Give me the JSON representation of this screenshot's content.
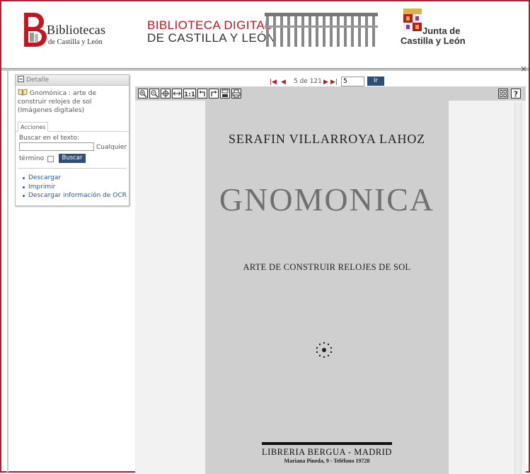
{
  "header": {
    "bibliotecas_logo": {
      "line1": "Bibliotecas",
      "line2": "de Castilla y León"
    },
    "digital_logo": {
      "line1": "BIBLIOTECA DIGITAL",
      "line2": "DE CASTILLA Y LEÓN"
    },
    "junta_logo": {
      "line1": "Junta de",
      "line2": "Castilla y León"
    },
    "close_glyph": "×"
  },
  "detalle_panel": {
    "header_label": "Detalle",
    "doc_title": "Gnomónica : arte de construir relojes de sol (Imágenes digitales)",
    "tab_label": "Acciones",
    "search_label": "Buscar en el texto:",
    "search_value": "",
    "cualquier_label": "Cualquier",
    "termino_label": "término",
    "buscar_button": "Buscar",
    "actions": [
      {
        "label": "Descargar"
      },
      {
        "label": "Imprimir"
      },
      {
        "label": "Descargar información de OCR"
      }
    ]
  },
  "viewer": {
    "pager": {
      "first_glyph": "|◀",
      "prev_glyph": "◀",
      "count_text": "5 de 121",
      "next_glyph": "▶",
      "last_glyph": "▶|",
      "page_value": "5",
      "go_button": "Ir",
      "current_page": 5,
      "total_pages": 121
    },
    "toolbar_icons": [
      "zoom-in-icon",
      "zoom-out-icon",
      "pan-icon",
      "fit-width-icon",
      "actual-size-icon",
      "rotate-left-icon",
      "rotate-right-icon",
      "save-icon",
      "print-icon",
      "thumbnails-icon",
      "help-icon"
    ],
    "actual_size_label": "1:1",
    "help_label": "?",
    "scanned_page": {
      "author": "SERAFIN VILLARROYA LAHOZ",
      "title": "GNOMONICA",
      "subtitle": "ARTE DE CONSTRUIR RELOJES DE SOL",
      "publisher": "LIBRERIA  BERGUA  -  MADRID",
      "address": "Mariana Pineda, 9 - Teléfono 19728"
    }
  },
  "colors": {
    "frame_border": "#b01f36",
    "button_blue": "#2e4d77",
    "link_blue": "#2557a3",
    "nav_red": "#c3171d"
  }
}
